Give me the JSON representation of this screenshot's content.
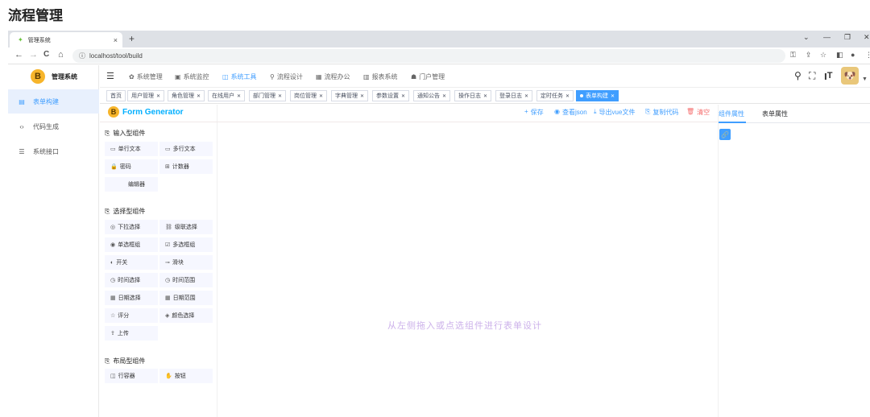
{
  "page_heading": "流程管理",
  "browser": {
    "tab_title": "管理系统",
    "tab_close": "×",
    "new_tab": "+",
    "url": "localhost/tool/build",
    "window_controls": [
      "⌄",
      "—",
      "❐",
      "✕"
    ],
    "nav": {
      "back": "←",
      "forward": "→",
      "reload": "C",
      "home": "⌂",
      "info": "ⓘ"
    }
  },
  "sidebar": {
    "logo_letter": "B",
    "title": "管理系统",
    "items": [
      {
        "icon": "▤",
        "label": "表单构建",
        "active": true
      },
      {
        "icon": "‹›",
        "label": "代码生成",
        "active": false
      },
      {
        "icon": "☰",
        "label": "系统接口",
        "active": false
      }
    ]
  },
  "topnav": {
    "hamburger": "☰",
    "items": [
      {
        "icon": "✿",
        "label": "系统管理"
      },
      {
        "icon": "▣",
        "label": "系统监控"
      },
      {
        "icon": "◫",
        "label": "系统工具"
      },
      {
        "icon": "⚲",
        "label": "流程设计"
      },
      {
        "icon": "▦",
        "label": "流程办公"
      },
      {
        "icon": "▥",
        "label": "报表系统"
      },
      {
        "icon": "☗",
        "label": "门户管理"
      }
    ],
    "active_index": 2,
    "tools": [
      "⚲",
      "⛶",
      "ꞁT"
    ]
  },
  "tags": [
    {
      "label": "首页",
      "closable": false
    },
    {
      "label": "用户管理",
      "closable": true
    },
    {
      "label": "角色管理",
      "closable": true
    },
    {
      "label": "在线用户",
      "closable": true
    },
    {
      "label": "部门管理",
      "closable": true
    },
    {
      "label": "岗位管理",
      "closable": true
    },
    {
      "label": "字典管理",
      "closable": true
    },
    {
      "label": "参数设置",
      "closable": true
    },
    {
      "label": "通知公告",
      "closable": true
    },
    {
      "label": "操作日志",
      "closable": true
    },
    {
      "label": "登录日志",
      "closable": true
    },
    {
      "label": "定时任务",
      "closable": true
    },
    {
      "label": "表单构建",
      "closable": true,
      "active": true
    }
  ],
  "form_generator": {
    "title": "Form Generator",
    "groups": [
      {
        "title": "输入型组件",
        "items": [
          {
            "icon": "▭",
            "label": "单行文本"
          },
          {
            "icon": "▭",
            "label": "多行文本"
          },
          {
            "icon": "🔒",
            "label": "密码"
          },
          {
            "icon": "⊞",
            "label": "计数器"
          },
          {
            "icon": "",
            "label": "编辑器"
          }
        ]
      },
      {
        "title": "选择型组件",
        "items": [
          {
            "icon": "◎",
            "label": "下拉选择"
          },
          {
            "icon": "⛓",
            "label": "级联选择"
          },
          {
            "icon": "◉",
            "label": "单选框组"
          },
          {
            "icon": "☑",
            "label": "多选框组"
          },
          {
            "icon": "◐",
            "label": "开关"
          },
          {
            "icon": "⊸",
            "label": "滑块"
          },
          {
            "icon": "◷",
            "label": "时间选择"
          },
          {
            "icon": "◷",
            "label": "时间范围"
          },
          {
            "icon": "▦",
            "label": "日期选择"
          },
          {
            "icon": "▦",
            "label": "日期范围"
          },
          {
            "icon": "☆",
            "label": "评分"
          },
          {
            "icon": "◈",
            "label": "颜色选择"
          },
          {
            "icon": "⇪",
            "label": "上传"
          }
        ]
      },
      {
        "title": "布局型组件",
        "items": [
          {
            "icon": "◫",
            "label": "行容器"
          },
          {
            "icon": "✋",
            "label": "按钮"
          }
        ]
      }
    ],
    "actions": [
      {
        "icon": "+",
        "label": "保存",
        "danger": false
      },
      {
        "icon": "◉",
        "label": "查看json",
        "danger": false
      },
      {
        "icon": "⤓",
        "label": "导出vue文件",
        "danger": false
      },
      {
        "icon": "⎘",
        "label": "复制代码",
        "danger": false
      },
      {
        "icon": "🗑",
        "label": "清空",
        "danger": true
      }
    ],
    "canvas_hint": "从左侧拖入或点选组件进行表单设计",
    "right_tabs": [
      {
        "label": "组件属性",
        "active": true
      },
      {
        "label": "表单属性",
        "active": false
      }
    ],
    "link_icon": "🔗"
  },
  "colors": {
    "accent": "#409eff",
    "danger": "#f56c6c",
    "title": "#00afff",
    "hint": "#ccb1ea"
  }
}
